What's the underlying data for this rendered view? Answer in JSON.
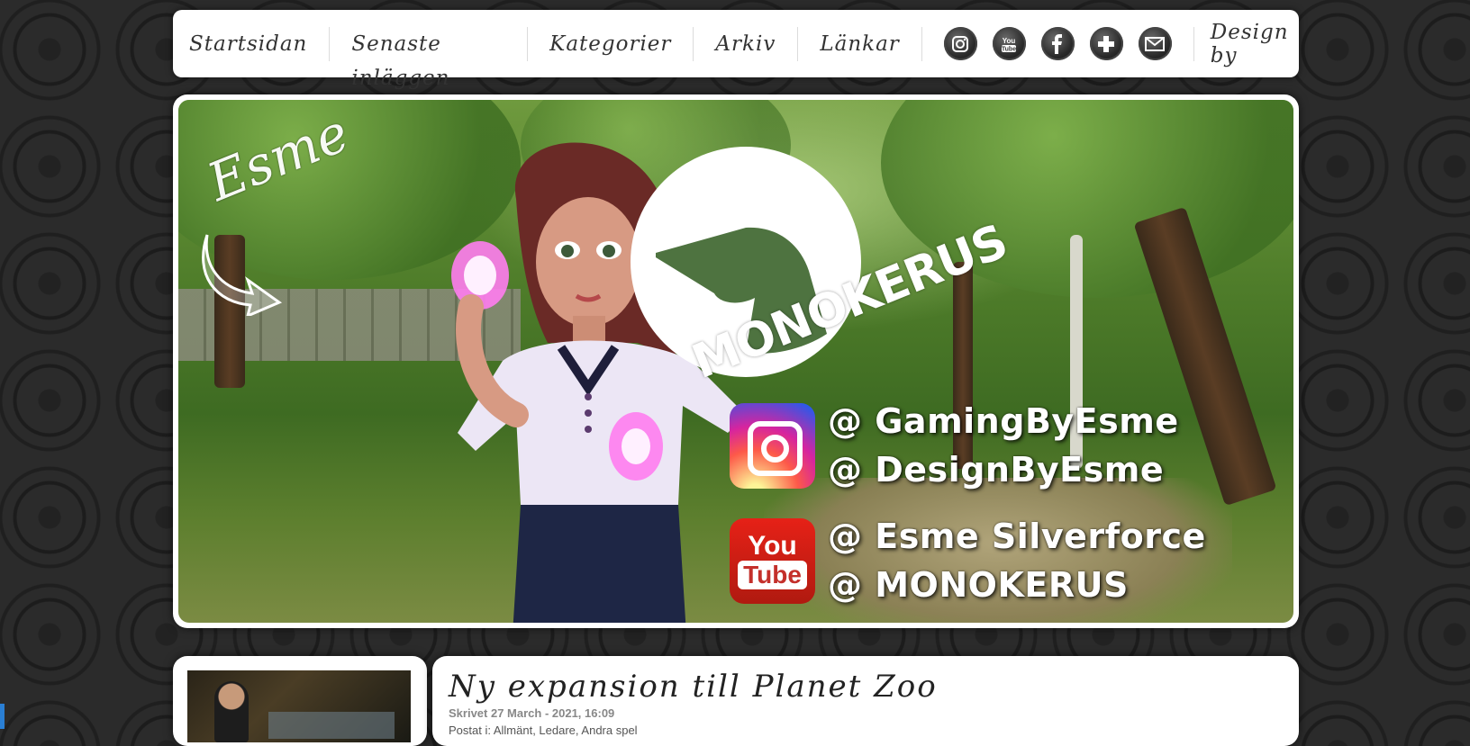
{
  "nav": {
    "items": [
      {
        "label": "Startsidan"
      },
      {
        "label": "Senaste inläggen"
      },
      {
        "label": "Kategorier"
      },
      {
        "label": "Arkiv"
      },
      {
        "label": "Länkar"
      }
    ],
    "social_icons": [
      "instagram-icon",
      "youtube-icon",
      "facebook-icon",
      "plus-icon",
      "mail-icon"
    ],
    "design_by": "Design by"
  },
  "banner": {
    "signature": "Esme",
    "brand": "MONOKERUS",
    "instagram_handles": [
      "@ GamingByEsme",
      "@ DesignByEsme"
    ],
    "youtube_handles": [
      "@ Esme Silverforce",
      "@ MONOKERUS"
    ],
    "youtube_icon": {
      "top": "You",
      "bottom": "Tube"
    }
  },
  "post": {
    "title": "Ny expansion till Planet Zoo",
    "meta": "Skrivet 27 March - 2021, 16:09",
    "category": "Postat i: Allmänt, Ledare, Andra spel"
  },
  "colors": {
    "page_bg": "#2b2b2b",
    "panel_bg": "#ffffff",
    "nav_text": "#333333",
    "youtube_red": "#e62117"
  }
}
